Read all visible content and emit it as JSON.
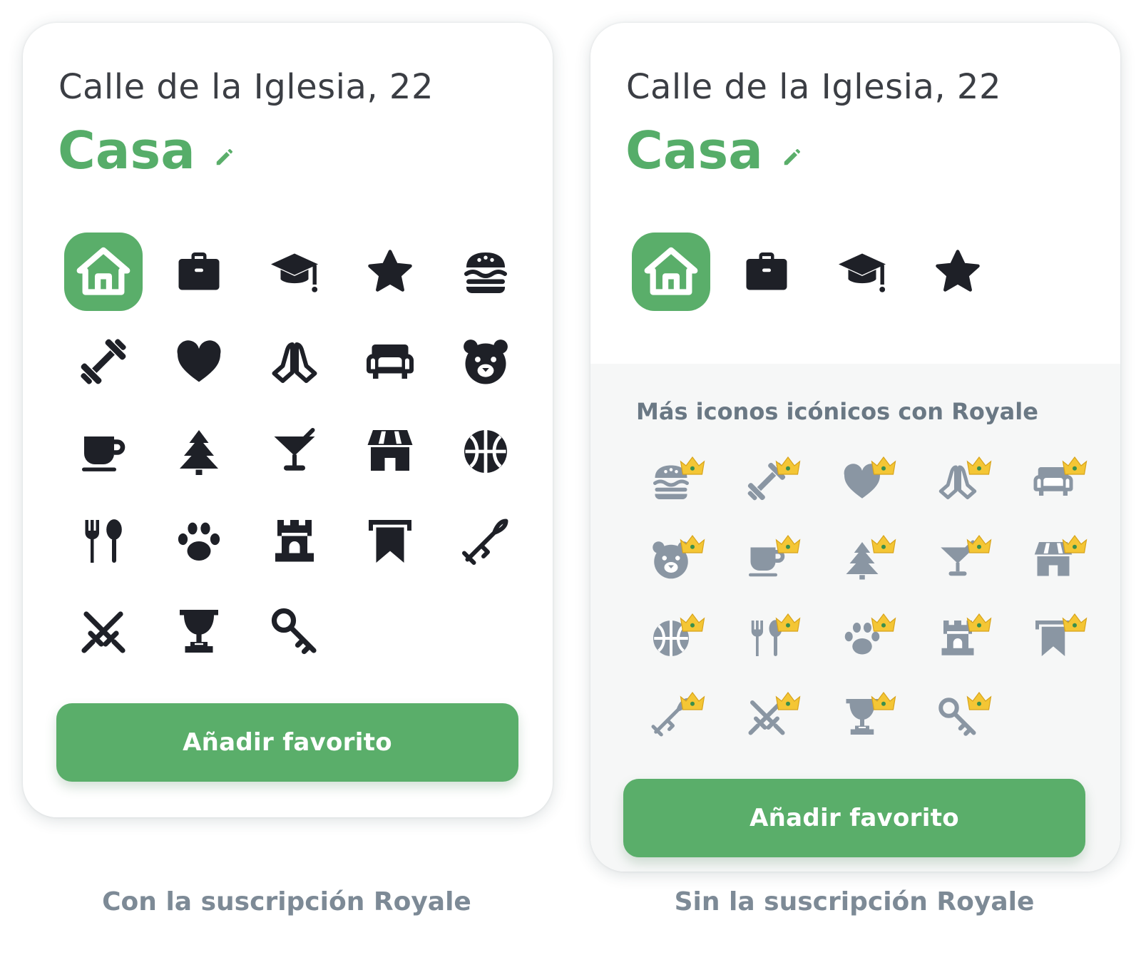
{
  "colors": {
    "accent": "#5aae6a",
    "icon_active": "#1e2027",
    "icon_locked": "#8a96a3",
    "crown_gold": "#f4c635",
    "panel_bg": "#f6f7f7"
  },
  "royale_card": {
    "address": "Calle de la Iglesia, 22",
    "title": "Casa",
    "icons": [
      "home-icon",
      "briefcase-icon",
      "graduation-cap-icon",
      "star-icon",
      "burger-icon",
      "dumbbell-icon",
      "heart-icon",
      "praying-hands-icon",
      "armchair-icon",
      "bear-icon",
      "coffee-cup-icon",
      "tree-icon",
      "cocktail-icon",
      "shop-icon",
      "basketball-icon",
      "fork-spoon-icon",
      "paw-icon",
      "castle-tower-icon",
      "banner-icon",
      "trumpet-icon",
      "crossed-swords-icon",
      "trophy-icon",
      "key-icon"
    ],
    "selected": "home-icon",
    "button_label": "Añadir favorito"
  },
  "free_card": {
    "address": "Calle de la Iglesia, 22",
    "title": "Casa",
    "icons": [
      "home-icon",
      "briefcase-icon",
      "graduation-cap-icon",
      "star-icon"
    ],
    "selected": "home-icon",
    "royale_heading": "Más iconos icónicos con Royale",
    "locked_icons": [
      "burger-icon",
      "dumbbell-icon",
      "heart-icon",
      "praying-hands-icon",
      "armchair-icon",
      "bear-icon",
      "coffee-cup-icon",
      "tree-icon",
      "cocktail-icon",
      "shop-icon",
      "basketball-icon",
      "fork-spoon-icon",
      "paw-icon",
      "castle-tower-icon",
      "banner-icon",
      "trumpet-icon",
      "crossed-swords-icon",
      "trophy-icon",
      "key-icon"
    ],
    "locked_badge": "crown-icon",
    "button_label": "Añadir favorito"
  },
  "captions": {
    "left": "Con la suscripción Royale",
    "right": "Sin la suscripción Royale"
  }
}
